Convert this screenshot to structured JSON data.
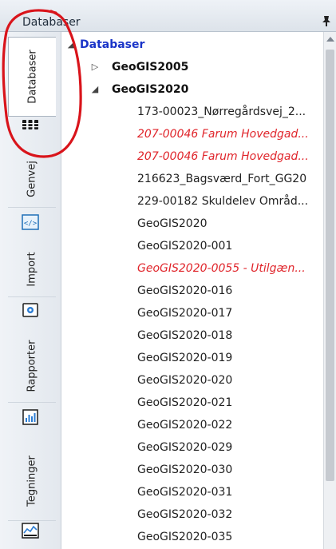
{
  "panel": {
    "title": "Databaser"
  },
  "tabs": [
    {
      "label": "Databaser",
      "active": true,
      "icon": "database-icon"
    },
    {
      "label": "Genvej",
      "active": false,
      "icon": "code-tag-icon"
    },
    {
      "label": "Import",
      "active": false,
      "icon": "import-icon"
    },
    {
      "label": "Rapporter",
      "active": false,
      "icon": "bar-chart-icon"
    },
    {
      "label": "Tegninger",
      "active": false,
      "icon": "line-chart-icon"
    }
  ],
  "tree": {
    "root": {
      "label": "Databaser",
      "expanded": true
    },
    "groups": [
      {
        "label": "GeoGIS2005",
        "expanded": false
      },
      {
        "label": "GeoGIS2020",
        "expanded": true,
        "items": [
          {
            "label": "173-00023_Nørregårdsvej_2...",
            "unavailable": false
          },
          {
            "label": "207-00046 Farum Hovedgad...",
            "unavailable": true
          },
          {
            "label": "207-00046 Farum Hovedgad...",
            "unavailable": true
          },
          {
            "label": "216623_Bagsværd_Fort_GG20",
            "unavailable": false
          },
          {
            "label": "229-00182 Skuldelev Områd...",
            "unavailable": false
          },
          {
            "label": "GeoGIS2020",
            "unavailable": false
          },
          {
            "label": "GeoGIS2020-001",
            "unavailable": false
          },
          {
            "label": "GeoGIS2020-0055 - Utilgæn...",
            "unavailable": true
          },
          {
            "label": "GeoGIS2020-016",
            "unavailable": false
          },
          {
            "label": "GeoGIS2020-017",
            "unavailable": false
          },
          {
            "label": "GeoGIS2020-018",
            "unavailable": false
          },
          {
            "label": "GeoGIS2020-019",
            "unavailable": false
          },
          {
            "label": "GeoGIS2020-020",
            "unavailable": false
          },
          {
            "label": "GeoGIS2020-021",
            "unavailable": false
          },
          {
            "label": "GeoGIS2020-022",
            "unavailable": false
          },
          {
            "label": "GeoGIS2020-029",
            "unavailable": false
          },
          {
            "label": "GeoGIS2020-030",
            "unavailable": false
          },
          {
            "label": "GeoGIS2020-031",
            "unavailable": false
          },
          {
            "label": "GeoGIS2020-032",
            "unavailable": false
          },
          {
            "label": "GeoGIS2020-035",
            "unavailable": false
          }
        ]
      }
    ]
  },
  "colors": {
    "root_text": "#1a34c8",
    "unavailable_text": "#e0252b",
    "annotation": "#d9141b"
  }
}
